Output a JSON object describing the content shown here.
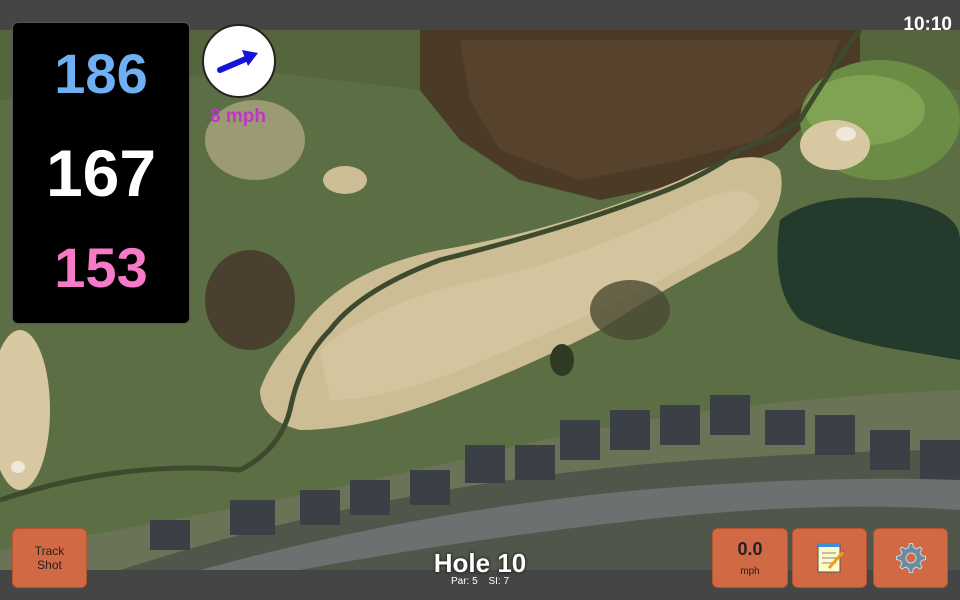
{
  "status_bar": {
    "time": "10:10"
  },
  "distances": {
    "back": "186",
    "middle": "167",
    "front": "153"
  },
  "wind": {
    "speed": "8 mph",
    "direction_icon": "wind-arrow-icon"
  },
  "hole": {
    "title": "Hole 10",
    "par": "Par: 5",
    "stroke_index": "SI: 7"
  },
  "buttons": {
    "track_shot_line1": "Track",
    "track_shot_line2": "Shot",
    "speed_value": "0.0",
    "speed_unit": "mph",
    "notes_icon": "notepad-icon",
    "settings_icon": "gear-icon"
  },
  "colors": {
    "back_distance": "#6fb0f5",
    "middle_distance": "#ffffff",
    "front_distance": "#f77ac8",
    "wind_text": "#c433c8",
    "button_bg": "#d16a44"
  }
}
